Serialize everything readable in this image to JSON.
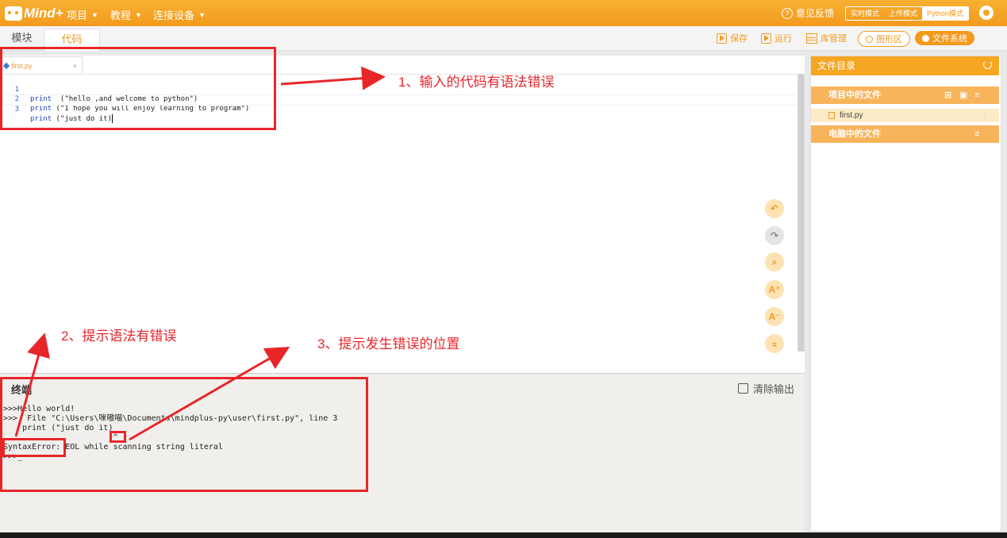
{
  "topbar": {
    "logo": "Mind+",
    "menus": [
      "项目",
      "教程",
      "连接设备"
    ],
    "feedback": "意见反馈",
    "modes": [
      "实时模式",
      "上传模式",
      "Python模式"
    ]
  },
  "subbar": {
    "tabs": [
      "模块",
      "代码"
    ],
    "tools": {
      "save": "保存",
      "run": "运行",
      "library": "库管理",
      "graphic": "图形区",
      "filesystem": "文件系统"
    }
  },
  "editor": {
    "file_tab": "first.py",
    "close": "×",
    "lines": [
      {
        "num": "1",
        "kw": "print",
        "rest": "  (\"hello ,and welcome to python\")"
      },
      {
        "num": "2",
        "kw": "print",
        "rest": " (\"I hope you will enjoy learning to program\")"
      },
      {
        "num": "3",
        "kw": "print",
        "rest": " (\"just do it)"
      }
    ],
    "side_buttons": [
      "undo-icon",
      "redo-icon",
      "search-icon",
      "font-increase-icon",
      "font-decrease-icon",
      "scroll-top-icon"
    ]
  },
  "terminal": {
    "title": "终端",
    "clear": "清除输出",
    "lines": [
      ">>>Hello world!",
      ">>>  File \"C:\\Users\\咪嗷喵\\Documents\\mindplus-py\\user\\first.py\", line 3",
      "    print (\"just do it)",
      "                       ^",
      "SyntaxError: EOL while scanning string literal",
      ">>>_"
    ]
  },
  "right_panel": {
    "title": "文件目录",
    "project_files": "项目中的文件",
    "file": "first.py",
    "computer_files": "电脑中的文件"
  },
  "annotations": {
    "a1": "1、输入的代码有语法错误",
    "a2": "2、提示语法有错误",
    "a3": "3、提示发生错误的位置"
  },
  "colors": {
    "accent": "#f39a1d",
    "annotation": "#e8262a"
  }
}
